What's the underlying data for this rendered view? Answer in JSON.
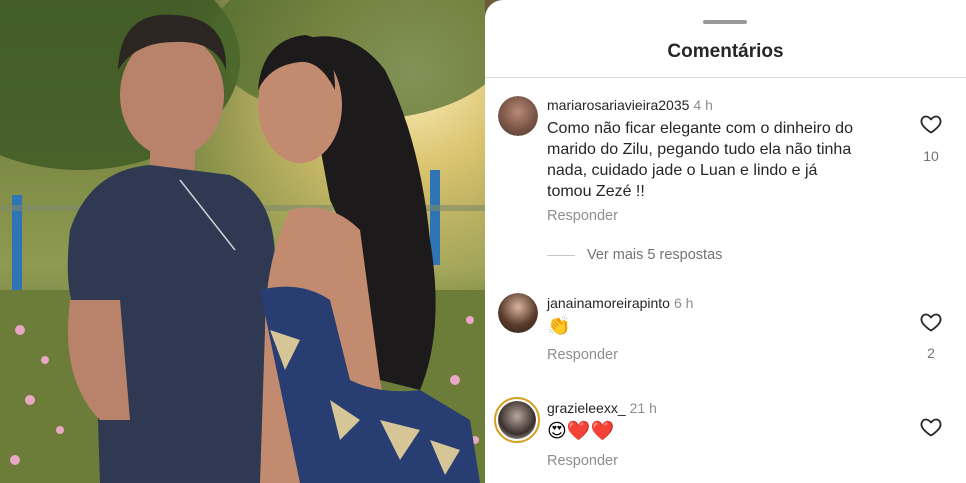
{
  "photo": {
    "description_icon": "couple-photo"
  },
  "panel": {
    "title": "Comentários",
    "colors": {
      "text": "#262626",
      "muted": "#8e8e8e",
      "accent_ring": "#d6a021"
    }
  },
  "comments": [
    {
      "username": "mariarosariavieira2035",
      "time": "4 h",
      "text_lines": [
        "Como não ficar elegante com o dinheiro do",
        "marido do Zilu, pegando tudo ela não tinha",
        "nada, cuidado jade o Luan e lindo e já",
        "tomou Zezé !!"
      ],
      "reply_label": "Responder",
      "likes": "10",
      "more_replies": "Ver mais 5 respostas"
    },
    {
      "username": "janainamoreirapinto",
      "time": "6 h",
      "emoji": "👏",
      "reply_label": "Responder",
      "likes": "2"
    },
    {
      "username": "grazieleexx_",
      "time": "21 h",
      "emoji": "😍❤️❤️",
      "reply_label": "Responder"
    }
  ]
}
